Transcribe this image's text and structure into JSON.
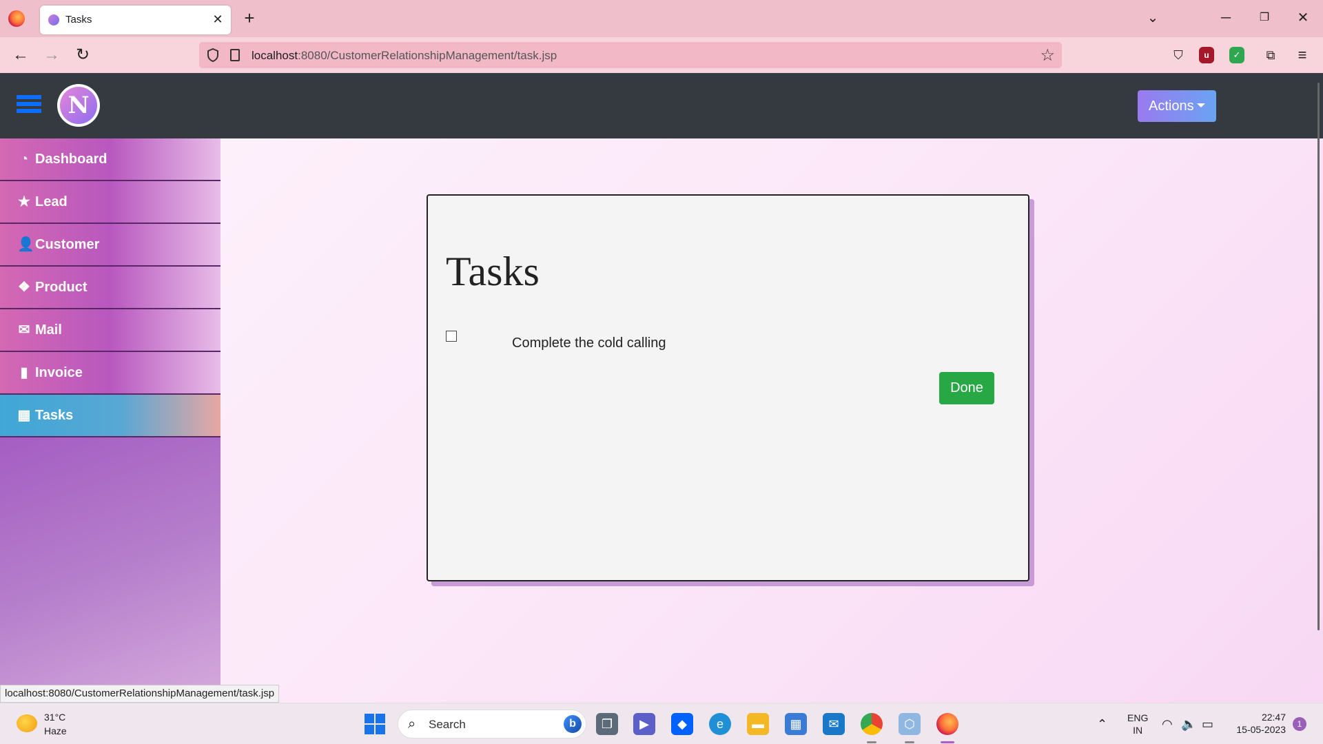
{
  "browser": {
    "tab_title": "Tasks",
    "tab_close": "✕",
    "new_tab": "+",
    "url_host": "localhost",
    "url_rest": ":8080/CustomerRelationshipManagement/task.jsp",
    "status_url": "localhost:8080/CustomerRelationshipManagement/task.jsp"
  },
  "app": {
    "logo_letter": "N",
    "actions_label": "Actions",
    "sidebar": {
      "items": [
        {
          "label": "Dashboard",
          "icon": "dashboard-icon"
        },
        {
          "label": "Lead",
          "icon": "star-icon"
        },
        {
          "label": "Customer",
          "icon": "user-icon"
        },
        {
          "label": "Product",
          "icon": "cubes-icon"
        },
        {
          "label": "Mail",
          "icon": "envelope-icon"
        },
        {
          "label": "Invoice",
          "icon": "file-icon"
        },
        {
          "label": "Tasks",
          "icon": "calendar-icon",
          "active": true
        }
      ]
    },
    "card": {
      "title": "Tasks",
      "tasks": [
        {
          "text": "Complete the cold calling",
          "checked": false
        }
      ],
      "done_label": "Done"
    },
    "colors": {
      "header": "#343a40",
      "done_button": "#28a745",
      "hamburger": "#0d6efd"
    }
  },
  "taskbar": {
    "weather_temp": "31°C",
    "weather_desc": "Haze",
    "search_placeholder": "Search",
    "lang_top": "ENG",
    "lang_bottom": "IN",
    "time": "22:47",
    "date": "15-05-2023",
    "notification_count": "1"
  }
}
